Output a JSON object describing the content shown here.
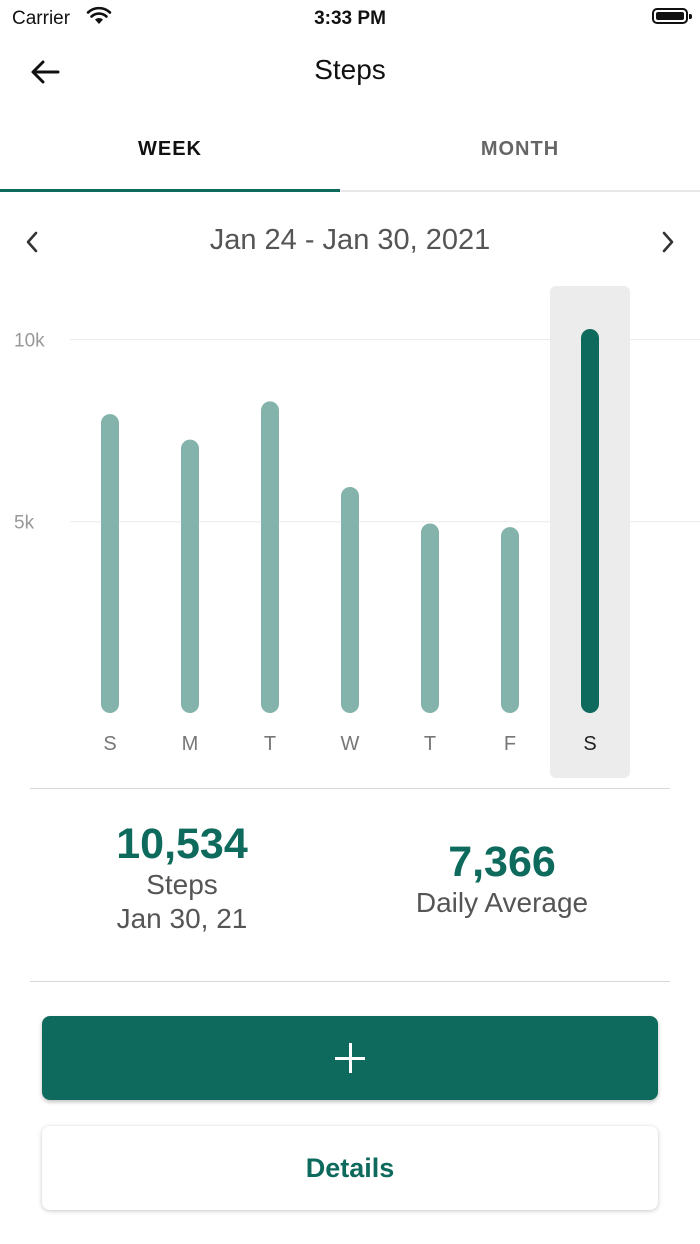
{
  "status_bar": {
    "carrier": "Carrier",
    "time": "3:33 PM"
  },
  "nav": {
    "title": "Steps"
  },
  "tabs": [
    {
      "label": "WEEK",
      "selected": true
    },
    {
      "label": "MONTH",
      "selected": false
    }
  ],
  "date_range": {
    "label": "Jan 24 - Jan 30, 2021"
  },
  "chart_data": {
    "type": "bar",
    "categories": [
      "S",
      "M",
      "T",
      "W",
      "T",
      "F",
      "S"
    ],
    "values": [
      8200,
      7500,
      8550,
      6200,
      5200,
      5100,
      10534
    ],
    "selected_index": 6,
    "yticks": [
      {
        "value": 5000,
        "label": "5k"
      },
      {
        "value": 10000,
        "label": "10k"
      }
    ],
    "ylim": [
      0,
      10534
    ],
    "colors": {
      "bar": "#83b3ab",
      "selected_bar": "#0e6a5c",
      "selected_bg": "#ececec"
    }
  },
  "summary": {
    "selected": {
      "value": "10,534",
      "unit": "Steps",
      "date": "Jan 30, 21"
    },
    "average": {
      "value": "7,366",
      "label": "Daily Average"
    }
  },
  "actions": {
    "add_symbol": "+",
    "details_label": "Details"
  },
  "colors": {
    "accent": "#0e6a5c"
  },
  "icons": {
    "back": "arrow-left-icon",
    "prev": "chevron-left-icon",
    "next": "chevron-right-icon",
    "add": "plus-icon"
  }
}
